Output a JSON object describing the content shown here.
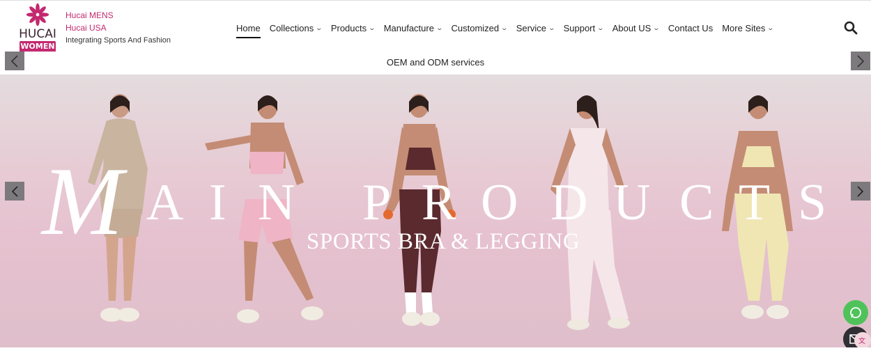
{
  "brand": {
    "wordmark": "HUCAI",
    "badge": "WOMEN",
    "colors": {
      "accent": "#c3296f",
      "dark": "#3b2330"
    }
  },
  "site_links": {
    "mens": "Hucai MENS",
    "usa": "Hucai USA",
    "tagline": "Integrating Sports And Fashion"
  },
  "nav": {
    "items": [
      {
        "label": "Home",
        "active": true,
        "dropdown": false
      },
      {
        "label": "Collections",
        "dropdown": true
      },
      {
        "label": "Products",
        "dropdown": true
      },
      {
        "label": "Manufacture",
        "dropdown": true
      },
      {
        "label": "Customized",
        "dropdown": true
      },
      {
        "label": "Service",
        "dropdown": true
      },
      {
        "label": "Support",
        "dropdown": true
      },
      {
        "label": "About US",
        "dropdown": true
      },
      {
        "label": "Contact Us",
        "dropdown": false
      },
      {
        "label": "More Sites",
        "dropdown": true
      }
    ],
    "search_icon": "search-icon"
  },
  "notice": {
    "text": "OEM and ODM services"
  },
  "hero": {
    "title_letters": [
      "M",
      "A",
      "I",
      "N",
      "P",
      "R",
      "O",
      "D",
      "U",
      "C",
      "T",
      "S"
    ],
    "subtitle": "SPORTS BRA & LEGGING",
    "outfit_colors": [
      "#c9b4a0",
      "#efb4c6",
      "#5a2a2e",
      "#f5e6ea",
      "#efe6b4"
    ]
  },
  "floating": {
    "whatsapp_icon": "whatsapp-icon",
    "email_icon": "email-icon",
    "translate_icon": "translate-icon"
  }
}
